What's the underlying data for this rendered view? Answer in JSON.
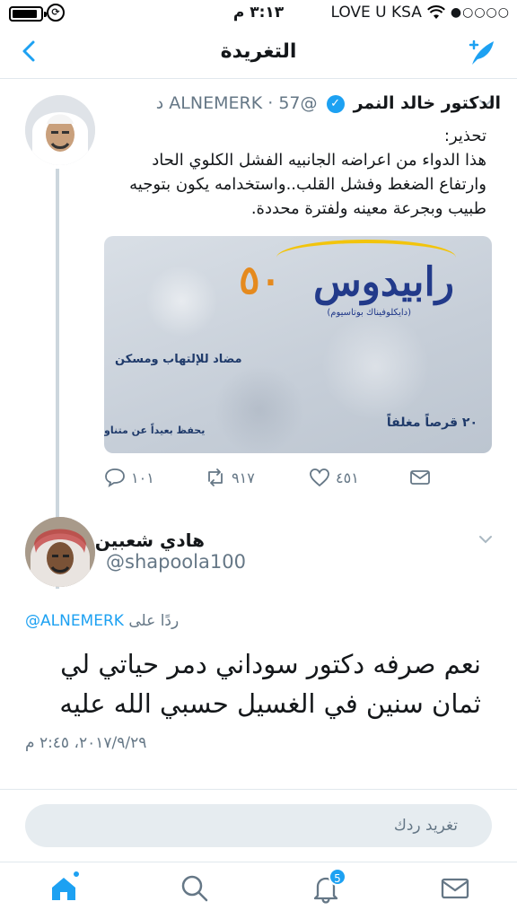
{
  "status_bar": {
    "time": "٣:١٣ م",
    "carrier": "LOVE U KSA",
    "signal_dots": "●○○○○",
    "battery_level": 0.9
  },
  "nav": {
    "title": "التغريدة",
    "back_icon": "chevron-left-icon",
    "compose_icon": "compose-tweet-icon"
  },
  "tweet": {
    "author_name": "الدكتور خالد النمر",
    "verified": true,
    "handle": "@ALNEMERK",
    "age": "57 د",
    "lines": [
      "تحذير:",
      "هذا الدواء من اعراضه الجانبيه الفشل الكلوي الحاد",
      "وارتفاع الضغط وفشل القلب..واستخدامه يكون بتوجيه",
      "طبيب وبجرعة معينه ولفترة محددة."
    ],
    "media": {
      "brand": "رابيدوس",
      "brand_number": "٥٠",
      "generic": "(دايكلوفيناك بوتاسيوم)",
      "description": "مضاد للإلتهاب ومسكن",
      "count": "٢٠ قرصاً مغلفاً",
      "storage": "يحفظ بعيداً عن متناو"
    },
    "actions": {
      "replies": "١٠١",
      "retweets": "٩١٧",
      "likes": "٤٥١"
    }
  },
  "reply": {
    "author_name": "هادي شعبين",
    "handle": "@shapoola100",
    "reply_prefix": "ردًا على",
    "reply_to": "@ALNEMERK",
    "text": "نعم صرفه دكتور سوداني دمر حياتي لي ثمان سنين في الغسيل حسبي الله عليه",
    "date": "٢٠١٧/٩/٢٩، ٢:٤٥ م"
  },
  "reply_box": {
    "placeholder": "تغريد ردك"
  },
  "tabs": {
    "notifications_badge": "5",
    "active": "home",
    "accent": "#1da1f2"
  }
}
